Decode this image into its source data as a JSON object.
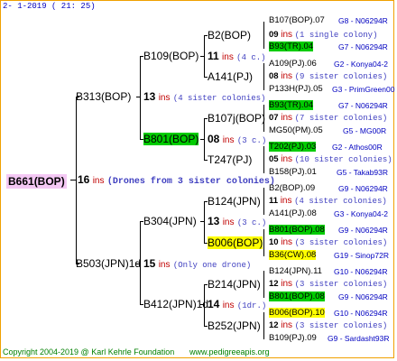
{
  "header": "2-  1-2019 ( 21: 25)",
  "footer": {
    "copyright": "Copyright 2004-2019 @ Karl Kehrle Foundation",
    "site": "www.pedigreeapis.org"
  },
  "root": {
    "name": "B661(BOP)",
    "num": "16",
    "ins": "ins",
    "note": "(Drones from 3 sister colonies)"
  },
  "l1": [
    {
      "name": "B313(BOP)",
      "num": "13",
      "ins": "ins",
      "note": "(4 sister colonies)"
    },
    {
      "name": "B503(JPN)1d",
      "num": "15",
      "ins": "ins",
      "note": "(Only one drone)"
    }
  ],
  "l2": [
    {
      "name": "B109(BOP)",
      "num": "11",
      "ins": "ins",
      "note": "(4 c.)"
    },
    {
      "name": "B801(BOP)",
      "num": "08",
      "ins": "ins",
      "note": "(3 c.)"
    },
    {
      "name": "B304(JPN)",
      "num": "13",
      "ins": "ins",
      "note": "(3 c.)"
    },
    {
      "name": "B412(JPN)1d",
      "num": "14",
      "ins": "ins",
      "note": "(1dr.)"
    }
  ],
  "l3": [
    {
      "name": "B2(BOP)"
    },
    {
      "name": "A141(PJ)"
    },
    {
      "name": "B107j(BOP)"
    },
    {
      "name": "T247(PJ)"
    },
    {
      "name": "B124(JPN)"
    },
    {
      "name": "B006(BOP)"
    },
    {
      "name": "B214(JPN)"
    },
    {
      "name": "B252(JPN)"
    }
  ],
  "l4": [
    {
      "a": "B107(BOP).07",
      "b": "G8 - N06294R"
    },
    {
      "a": "09",
      "ins": "ins",
      "c": "(1 single colony)"
    },
    {
      "a": "B93(TR).04",
      "b": "G7 - N06294R"
    },
    {
      "a": "A109(PJ).06",
      "b": "G2 - Konya04-2"
    },
    {
      "a": "08",
      "ins": "ins",
      "c": "(9 sister colonies)"
    },
    {
      "a": "P133H(PJ).05",
      "b": "G3 - PrimGreen00"
    },
    {
      "a": "B93(TR).04",
      "b": "G7 - N06294R"
    },
    {
      "a": "07",
      "ins": "ins",
      "c": "(7 sister colonies)"
    },
    {
      "a": "MG50(PM).05",
      "b": "G5 - MG00R"
    },
    {
      "a": "T202(PJ).03",
      "b": "G2 - Athos00R"
    },
    {
      "a": "05",
      "ins": "ins",
      "c": "(10 sister colonies)"
    },
    {
      "a": "B158(PJ).01",
      "b": "G5 - Takab93R"
    },
    {
      "a": "B2(BOP).09",
      "b": "G9 - N06294R"
    },
    {
      "a": "11",
      "ins": "ins",
      "c": "(4 sister colonies)"
    },
    {
      "a": "A141(PJ).08",
      "b": "G3 - Konya04-2"
    },
    {
      "a": "B801(BOP).08",
      "b": "G9 - N06294R"
    },
    {
      "a": "10",
      "ins": "ins",
      "c": "(3 sister colonies)"
    },
    {
      "a": "B36(CW).08",
      "b": "G19 - Sinop72R"
    },
    {
      "a": "B124(JPN).11",
      "b": "G10 - N06294R"
    },
    {
      "a": "12",
      "ins": "ins",
      "c": "(3 sister colonies)"
    },
    {
      "a": "B801(BOP).08",
      "b": "G9 - N06294R"
    },
    {
      "a": "B006(BOP).10",
      "b": "G10 - N06294R"
    },
    {
      "a": "12",
      "ins": "ins",
      "c": "(3 sister colonies)"
    },
    {
      "a": "B109(PJ).09",
      "b": "G9 - Sardasht93R"
    }
  ]
}
